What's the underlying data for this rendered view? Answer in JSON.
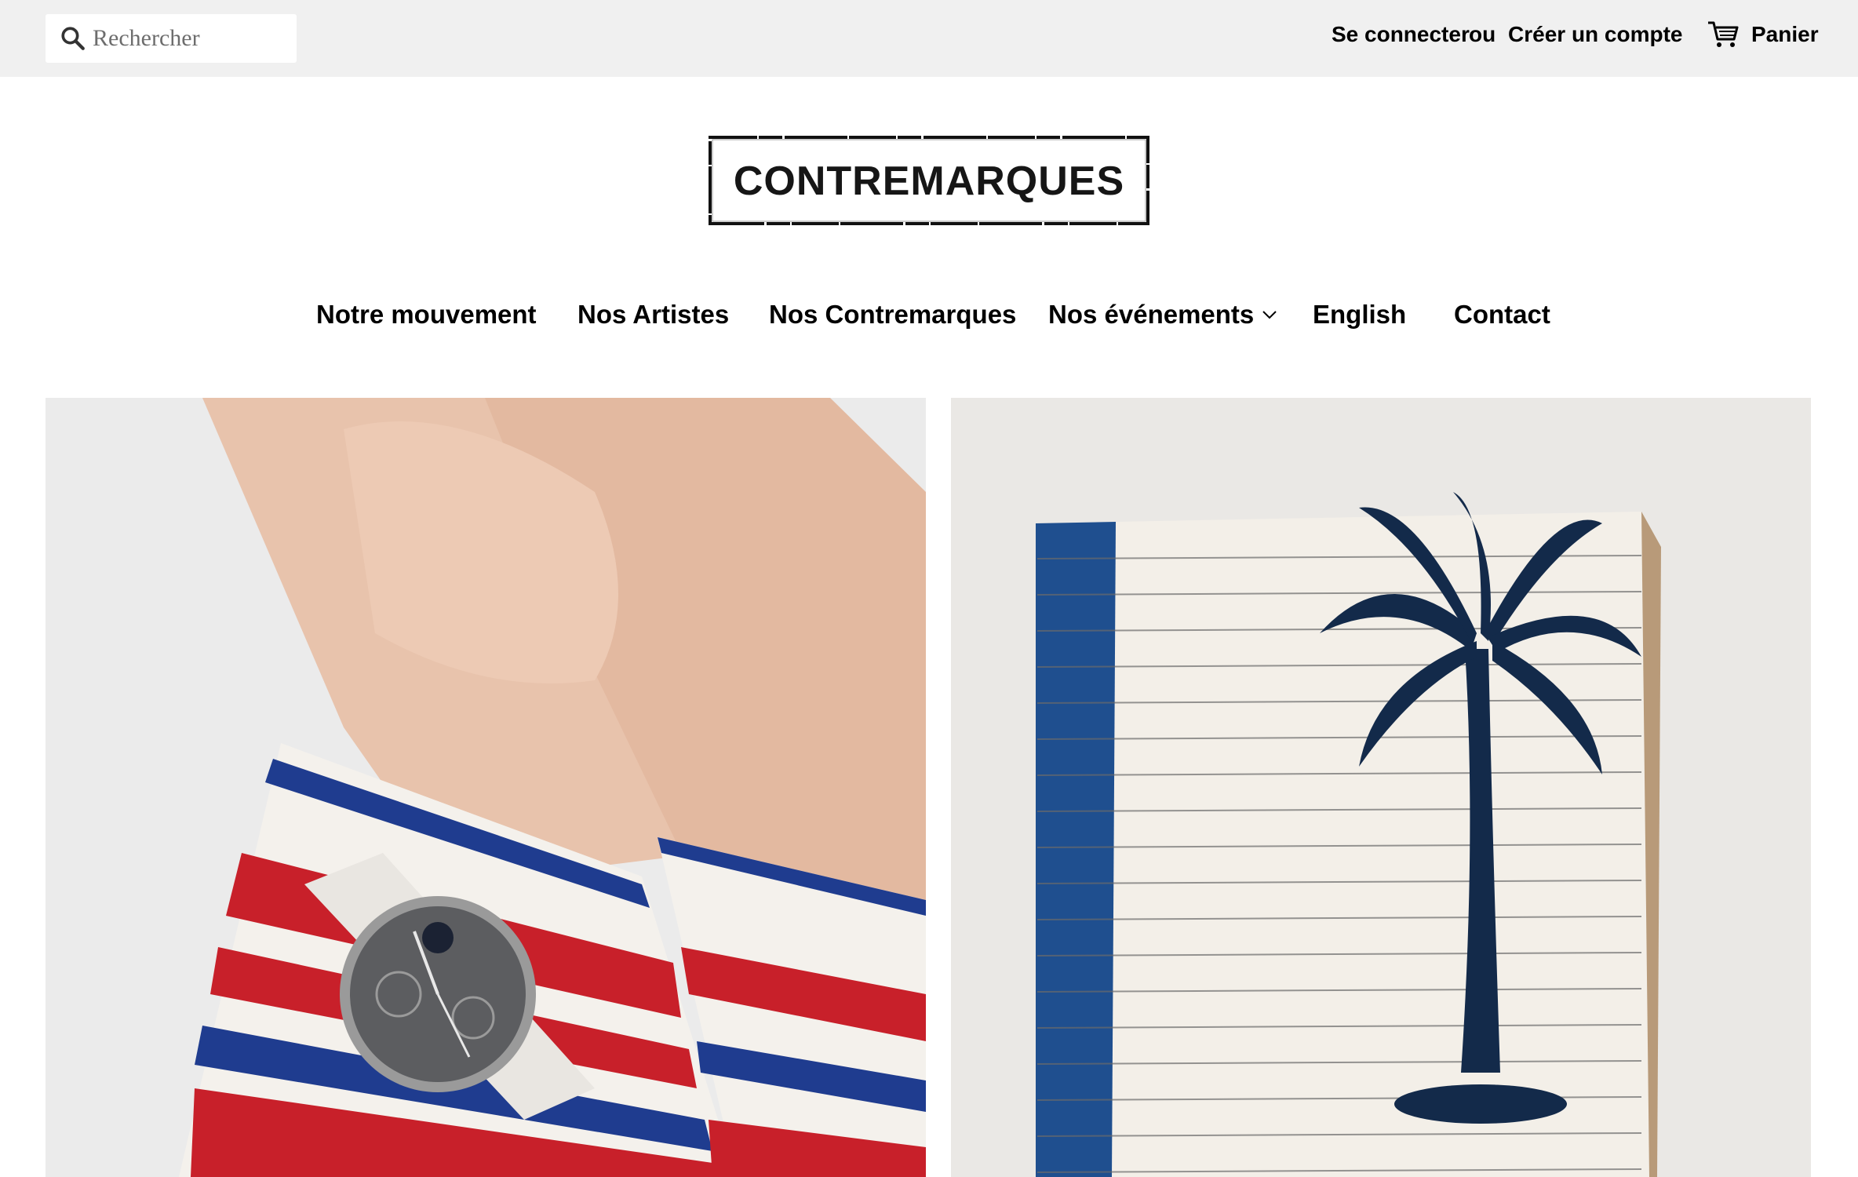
{
  "search": {
    "placeholder": "Rechercher",
    "icon": "search-icon"
  },
  "account": {
    "login_label": "Se connecter",
    "or_label": "ou",
    "register_label": "Créer un compte"
  },
  "cart": {
    "label": "Panier",
    "icon": "cart-icon"
  },
  "logo": {
    "text": "CONTREMARQUES"
  },
  "nav": {
    "items": [
      {
        "label": "Notre mouvement"
      },
      {
        "label": "Nos Artistes"
      },
      {
        "label": "Nos Contremarques"
      },
      {
        "label": "Nos événements"
      },
      {
        "label": "English"
      },
      {
        "label": "Contact"
      }
    ]
  },
  "colors": {
    "topbar_bg": "#f0f0f0",
    "text": "#000000",
    "stripe_red": "#c8202a",
    "stripe_blue": "#1f3c8f"
  }
}
